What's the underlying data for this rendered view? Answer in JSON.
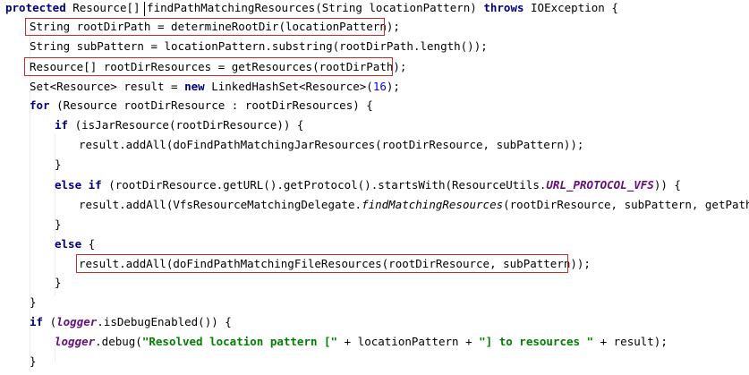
{
  "lines": [
    {
      "segments": [
        {
          "text": "protected",
          "cls": "kw"
        },
        {
          "text": " Resource[] ",
          "cls": ""
        },
        {
          "text": "findPathMatchingResources(String locationPattern) ",
          "cls": ""
        },
        {
          "text": "throws",
          "cls": "kw"
        },
        {
          "text": " IOException {",
          "cls": ""
        }
      ]
    },
    {
      "segments": [
        {
          "text": "String rootDirPath = determineRootDir(locationPattern);",
          "cls": ""
        }
      ]
    },
    {
      "segments": [
        {
          "text": "String subPattern = locationPattern.substring(rootDirPath.length());",
          "cls": ""
        }
      ]
    },
    {
      "segments": [
        {
          "text": "Resource[] rootDirResources = getResources(rootDirPath);",
          "cls": ""
        }
      ]
    },
    {
      "segments": [
        {
          "text": "Set<Resource> result = ",
          "cls": ""
        },
        {
          "text": "new",
          "cls": "kw"
        },
        {
          "text": " LinkedHashSet<Resource>(",
          "cls": ""
        },
        {
          "text": "16",
          "cls": "num"
        },
        {
          "text": ");",
          "cls": ""
        }
      ]
    },
    {
      "segments": [
        {
          "text": "for",
          "cls": "kw"
        },
        {
          "text": " (Resource rootDirResource : rootDirResources) {",
          "cls": ""
        }
      ]
    },
    {
      "segments": [
        {
          "text": "if",
          "cls": "kw"
        },
        {
          "text": " (isJarResource(rootDirResource)) {",
          "cls": ""
        }
      ]
    },
    {
      "segments": [
        {
          "text": "result.addAll(doFindPathMatchingJarResources(rootDirResource, subPattern));",
          "cls": ""
        }
      ]
    },
    {
      "segments": [
        {
          "text": "}",
          "cls": ""
        }
      ]
    },
    {
      "segments": [
        {
          "text": "else if",
          "cls": "kw"
        },
        {
          "text": " (rootDirResource.getURL().getProtocol().startsWith(ResourceUtils.",
          "cls": ""
        },
        {
          "text": "URL_PROTOCOL_VFS",
          "cls": "fld"
        },
        {
          "text": ")) {",
          "cls": ""
        }
      ]
    },
    {
      "segments": [
        {
          "text": "result.addAll(VfsResourceMatchingDelegate.",
          "cls": ""
        },
        {
          "text": "findMatchingResources",
          "cls": "italic"
        },
        {
          "text": "(rootDirResource, subPattern, getPathMatcher",
          "cls": ""
        }
      ]
    },
    {
      "segments": [
        {
          "text": "}",
          "cls": ""
        }
      ]
    },
    {
      "segments": [
        {
          "text": "else",
          "cls": "kw"
        },
        {
          "text": " {",
          "cls": ""
        }
      ]
    },
    {
      "segments": [
        {
          "text": "result.addAll(doFindPathMatchingFileResources(rootDirResource, subPattern));",
          "cls": ""
        }
      ]
    },
    {
      "segments": [
        {
          "text": "}",
          "cls": ""
        }
      ]
    },
    {
      "segments": [
        {
          "text": "}",
          "cls": ""
        }
      ]
    },
    {
      "segments": [
        {
          "text": "if",
          "cls": "kw"
        },
        {
          "text": " (",
          "cls": ""
        },
        {
          "text": "logger",
          "cls": "fld"
        },
        {
          "text": ".isDebugEnabled()) {",
          "cls": ""
        }
      ]
    },
    {
      "segments": [
        {
          "text": "logger",
          "cls": "fld"
        },
        {
          "text": ".debug(",
          "cls": ""
        },
        {
          "text": "\"Resolved location pattern [\"",
          "cls": "str"
        },
        {
          "text": " + locationPattern + ",
          "cls": ""
        },
        {
          "text": "\"] to resources \"",
          "cls": "str"
        },
        {
          "text": " + result);",
          "cls": ""
        }
      ]
    },
    {
      "segments": [
        {
          "text": "}",
          "cls": ""
        }
      ]
    }
  ],
  "colors": {
    "background": "#ffffff",
    "keyword": "#000080",
    "static_field": "#660e7a",
    "number": "#0000ff",
    "string": "#008000",
    "highlight_box": "#cc2b2b"
  }
}
